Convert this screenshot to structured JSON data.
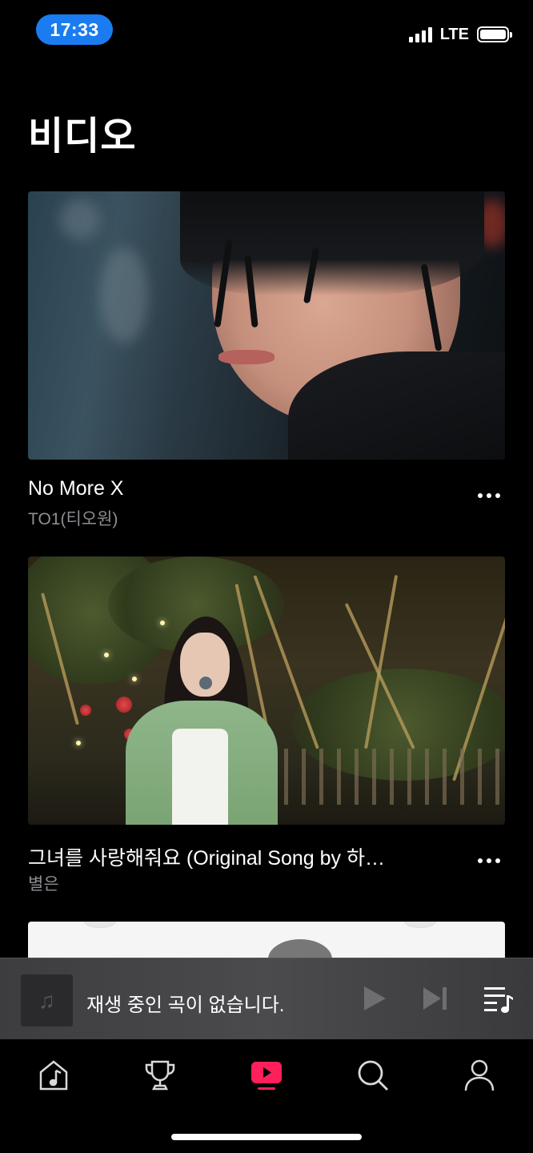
{
  "status_bar": {
    "time": "17:33",
    "network": "LTE",
    "signal_icon": "signal-bars-icon",
    "battery_icon": "battery-icon"
  },
  "page": {
    "title": "비디오"
  },
  "videos": [
    {
      "title": "No More X",
      "artist": "TO1(티오원)",
      "more_icon": "more-horizontal-icon"
    },
    {
      "title": "그녀를 사랑해줘요 (Original Song by 하…",
      "artist": "별은",
      "more_icon": "more-horizontal-icon"
    }
  ],
  "mini_player": {
    "status_text": "재생 중인 곡이 없습니다.",
    "art_icon": "music-note-icon",
    "play_icon": "play-icon",
    "next_icon": "skip-next-icon",
    "queue_icon": "playlist-icon"
  },
  "tab_bar": {
    "tabs": [
      {
        "icon": "music-home-icon",
        "active": false
      },
      {
        "icon": "trophy-icon",
        "active": false
      },
      {
        "icon": "video-play-icon",
        "active": true
      },
      {
        "icon": "search-icon",
        "active": false
      },
      {
        "icon": "profile-icon",
        "active": false
      }
    ],
    "active_color": "#ff1f5a",
    "inactive_color": "#d9d9d9"
  },
  "colors": {
    "time_pill": "#1a7cf0",
    "background": "#000000",
    "secondary_text": "#8e8e93"
  }
}
